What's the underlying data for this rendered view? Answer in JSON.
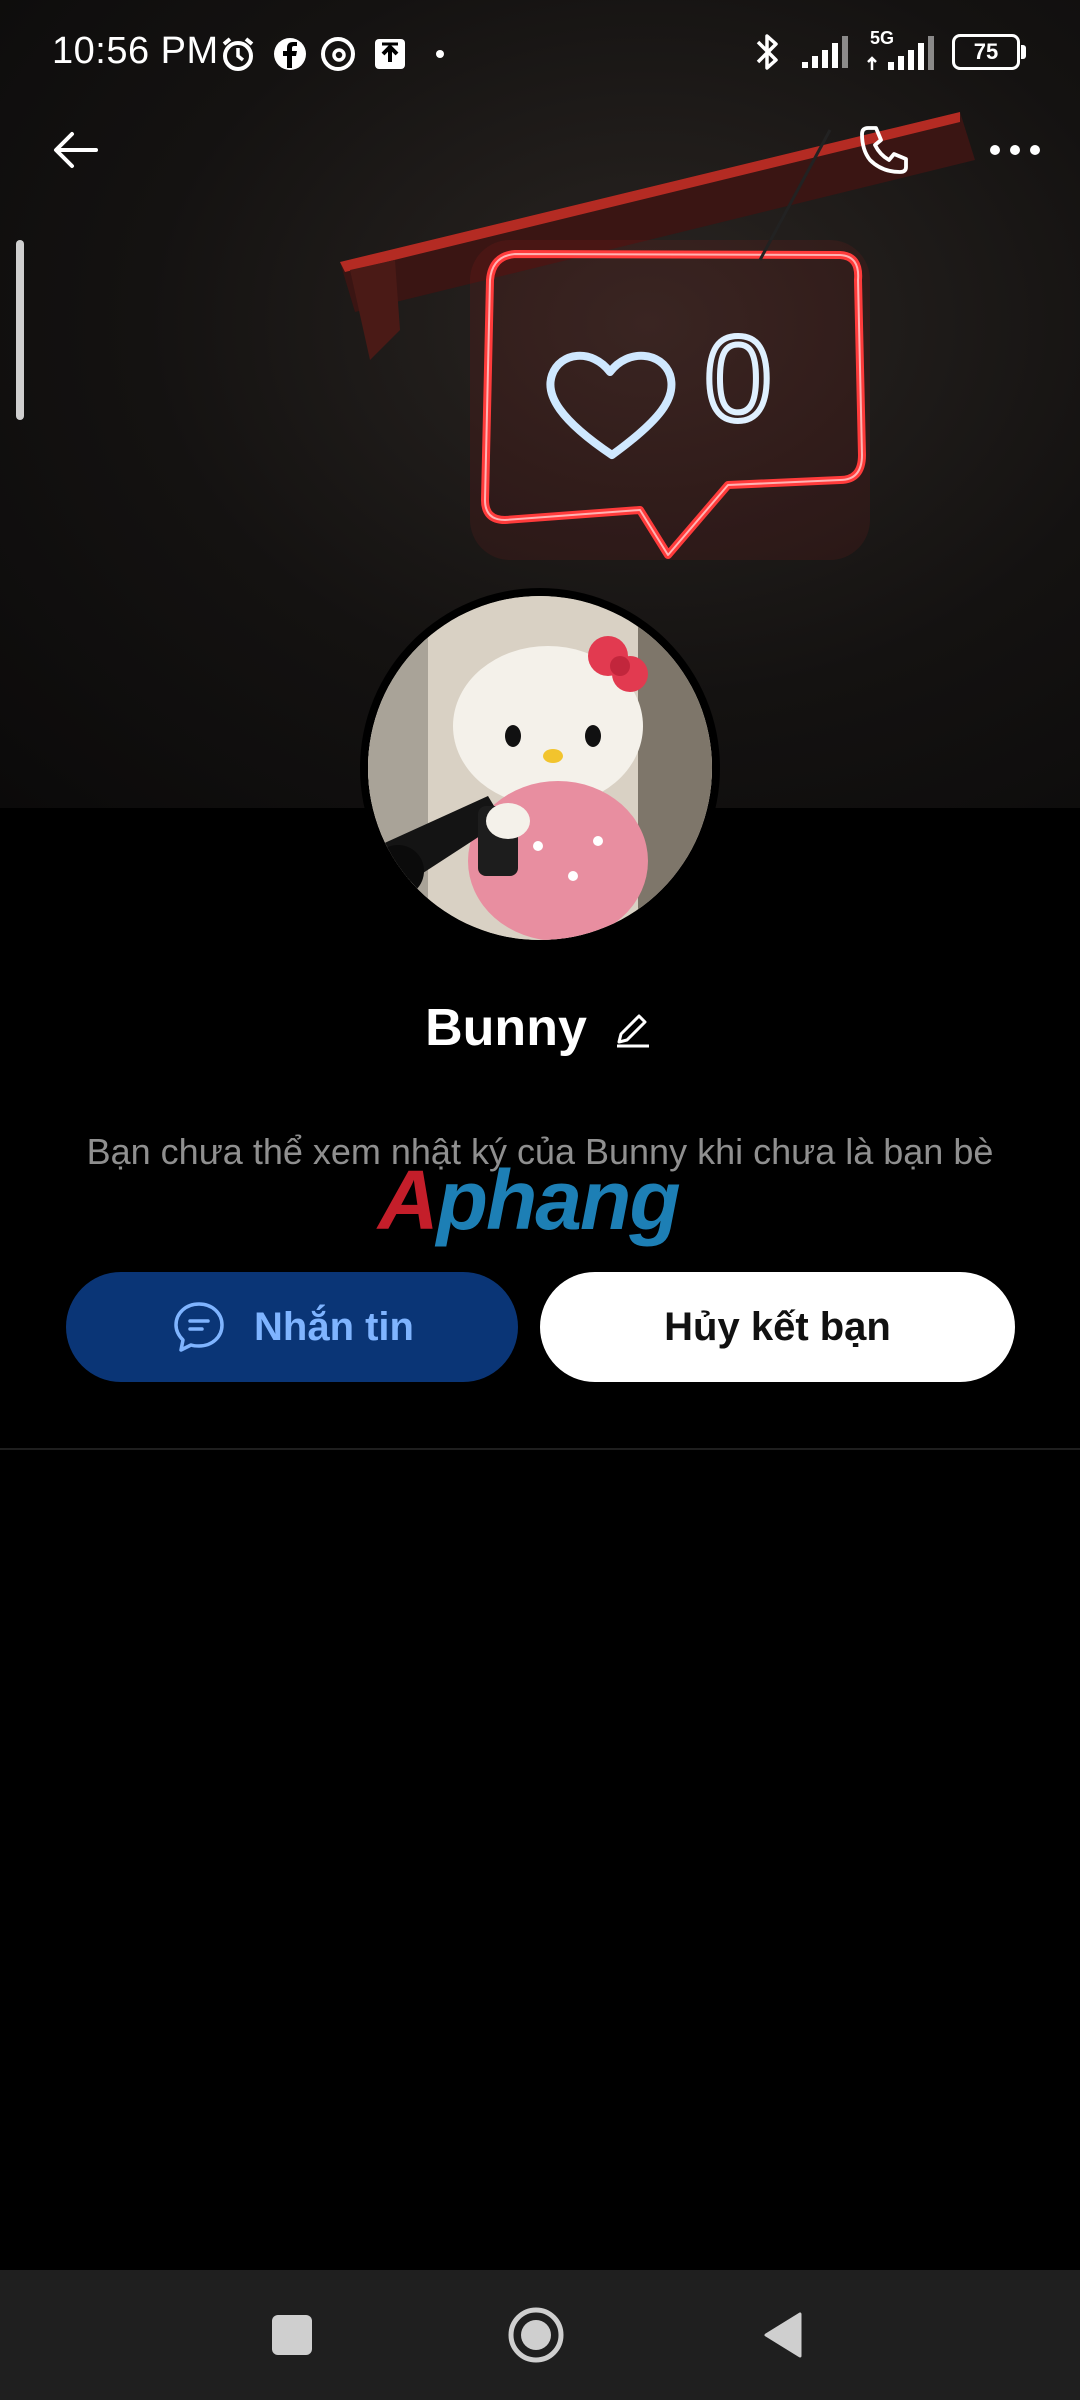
{
  "status_bar": {
    "time": "10:56 PM",
    "network": "5G",
    "battery": "75"
  },
  "header": {
    "back_icon": "arrow-left-icon",
    "call_icon": "phone-icon",
    "more_icon": "more-horizontal-icon"
  },
  "cover": {
    "neon_count": "0"
  },
  "profile": {
    "name": "Bunny",
    "edit_icon": "pencil-icon",
    "description": "Bạn chưa thể xem nhật ký của Bunny khi chưa là bạn bè"
  },
  "watermark": {
    "part1": "A",
    "part2": "phang"
  },
  "actions": {
    "message_label": "Nhắn tin",
    "unfriend_label": "Hủy kết bạn"
  },
  "colors": {
    "message_button_bg": "#0a3576",
    "message_button_text": "#7fb4ff",
    "neon_red": "#ff3b3b",
    "neon_white": "#dff0ff"
  }
}
